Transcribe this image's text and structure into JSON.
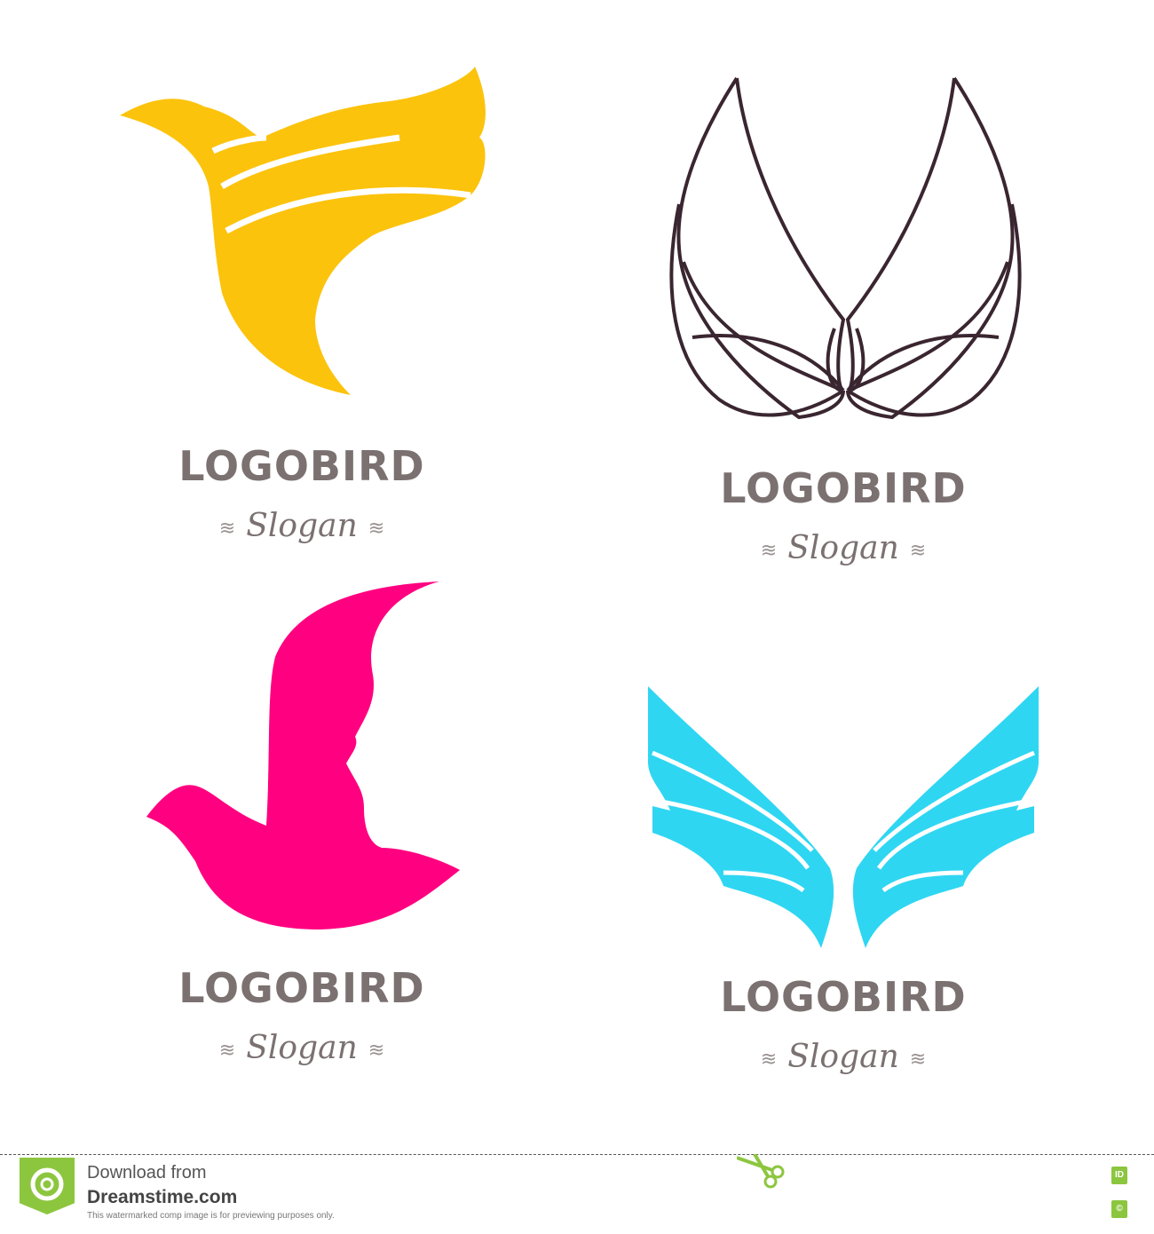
{
  "logos": [
    {
      "name": "LOGOBIRD",
      "slogan": "Slogan",
      "color": "#fcc30d"
    },
    {
      "name": "LOGOBIRD",
      "slogan": "Slogan",
      "color": "#3a2630"
    },
    {
      "name": "LOGOBIRD",
      "slogan": "Slogan",
      "color": "#ff0080"
    },
    {
      "name": "LOGOBIRD",
      "slogan": "Slogan",
      "color": "#2fd6f2"
    }
  ],
  "footer": {
    "line1": "Download from",
    "line2": "Dreamstime.com",
    "line3": "This watermarked comp image is for previewing purposes only.",
    "id_badge": "ID",
    "copyright_badge": "©"
  }
}
